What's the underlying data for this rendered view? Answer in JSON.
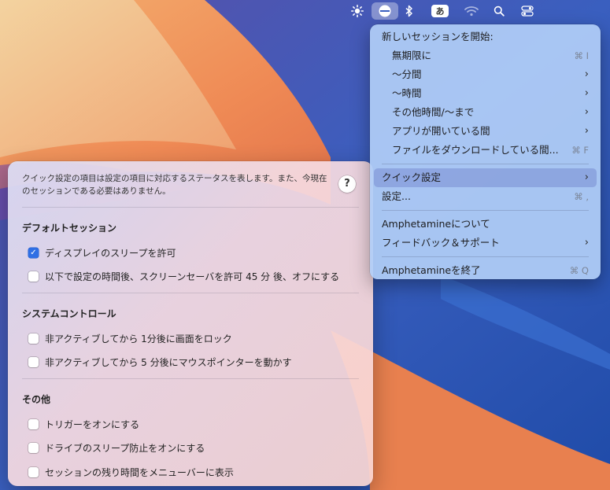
{
  "colors": {
    "accent": "#2f6fe4",
    "menu_bg": "#b0cdf6",
    "highlight": "#788cd2"
  },
  "menubar": {
    "icons": [
      "sun-brightness-icon",
      "amphetamine-pill-icon",
      "bluetooth-icon",
      "input-method-icon",
      "wifi-icon",
      "search-icon",
      "control-center-icon"
    ],
    "ime_label": "あ"
  },
  "menu": {
    "header": "新しいセッションを開始:",
    "session_items": [
      {
        "label": "無期限に",
        "shortcut": "⌘ I"
      },
      {
        "label": "〜分間",
        "submenu": "›"
      },
      {
        "label": "〜時間",
        "submenu": "›"
      },
      {
        "label": "その他時間/〜まで",
        "submenu": "›"
      },
      {
        "label": "アプリが開いている間",
        "submenu": "›"
      },
      {
        "label": "ファイルをダウンロードしている間...",
        "shortcut": "⌘ F"
      }
    ],
    "quick_settings": {
      "label": "クイック設定",
      "submenu": "›"
    },
    "settings": {
      "label": "設定...",
      "shortcut": "⌘ ,"
    },
    "about": {
      "label": "Amphetamineについて"
    },
    "feedback": {
      "label": "フィードバック＆サポート",
      "submenu": "›"
    },
    "quit": {
      "label": "Amphetamineを終了",
      "shortcut": "⌘ Q"
    }
  },
  "panel": {
    "description": "クイック設定の項目は設定の項目に対応するステータスを表します。また、今現在のセッションである必要はありません。",
    "help": "?",
    "sections": [
      {
        "title": "デフォルトセッション",
        "items": [
          {
            "label": "ディスプレイのスリープを許可",
            "checked": true
          },
          {
            "label": "以下で設定の時間後、スクリーンセーバを許可 45 分 後、オフにする",
            "checked": false
          }
        ]
      },
      {
        "title": "システムコントロール",
        "items": [
          {
            "label": "非アクティブしてから 1分後に画面をロック",
            "checked": false
          },
          {
            "label": "非アクティブしてから 5 分後にマウスポインターを動かす",
            "checked": false
          }
        ]
      },
      {
        "title": "その他",
        "items": [
          {
            "label": "トリガーをオンにする",
            "checked": false
          },
          {
            "label": "ドライブのスリープ防止をオンにする",
            "checked": false
          },
          {
            "label": "セッションの残り時間をメニューバーに表示",
            "checked": false
          }
        ]
      }
    ]
  }
}
